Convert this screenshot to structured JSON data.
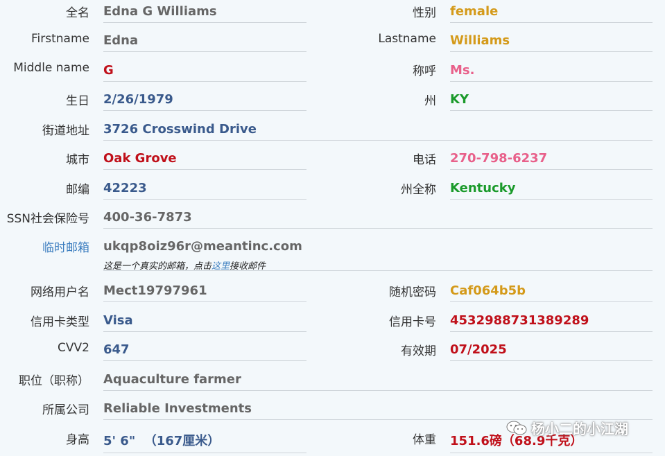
{
  "rows": [
    {
      "left_label": "全名",
      "left_value": "Edna G Williams",
      "right_label": "性别",
      "right_value": "female"
    },
    {
      "left_label": "Firstname",
      "left_value": "Edna",
      "right_label": "Lastname",
      "right_value": "Williams"
    },
    {
      "left_label": "Middle name",
      "left_value": "G",
      "right_label": "称呼",
      "right_value": "Ms."
    },
    {
      "left_label": "生日",
      "left_value": "2/26/1979",
      "right_label": "州",
      "right_value": "KY"
    },
    {
      "left_label": "街道地址",
      "left_value": "3726 Crosswind Drive"
    },
    {
      "left_label": "城市",
      "left_value": "Oak Grove",
      "right_label": "电话",
      "right_value": "270-798-6237"
    },
    {
      "left_label": "邮编",
      "left_value": "42223",
      "right_label": "州全称",
      "right_value": "Kentucky"
    },
    {
      "left_label": "SSN社会保险号",
      "left_value": "400-36-7873"
    },
    {
      "left_label": "临时邮箱",
      "left_value": "ukqp8oiz96r@meantinc.com",
      "note_before": "这是一个真实的邮箱，点击",
      "note_link": "这里",
      "note_after": "接收邮件"
    },
    {
      "left_label": "网络用户名",
      "left_value": "Mect19797961",
      "right_label": "随机密码",
      "right_value": "Caf064b5b"
    },
    {
      "left_label": "信用卡类型",
      "left_value": "Visa",
      "right_label": "信用卡号",
      "right_value": "4532988731389289"
    },
    {
      "left_label": "CVV2",
      "left_value": "647",
      "right_label": "有效期",
      "right_value": "07/2025"
    },
    {
      "left_label": "职位（职称）",
      "left_value": "Aquaculture farmer"
    },
    {
      "left_label": "所属公司",
      "left_value": "Reliable Investments"
    },
    {
      "left_label": "身高",
      "left_value": "5' 6\"  （167厘米）",
      "right_label": "体重",
      "right_value": "151.6磅（68.9千克）"
    }
  ],
  "watermark": "杨小二的小江湖",
  "icons": {
    "watermark_icon": "wechat-icon"
  }
}
